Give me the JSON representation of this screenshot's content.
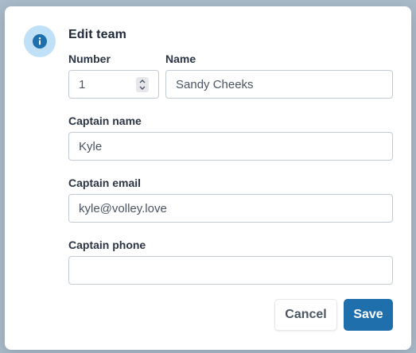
{
  "dialog": {
    "title": "Edit team",
    "icon": "info-icon",
    "accent_color": "#1f6fad",
    "icon_bg_color": "#bfe0f7"
  },
  "form": {
    "number": {
      "label": "Number",
      "value": "1"
    },
    "name": {
      "label": "Name",
      "value": "Sandy Cheeks"
    },
    "captain_name": {
      "label": "Captain name",
      "value": "Kyle"
    },
    "captain_email": {
      "label": "Captain email",
      "value": "kyle@volley.love"
    },
    "captain_phone": {
      "label": "Captain phone",
      "value": ""
    }
  },
  "actions": {
    "cancel_label": "Cancel",
    "save_label": "Save"
  }
}
